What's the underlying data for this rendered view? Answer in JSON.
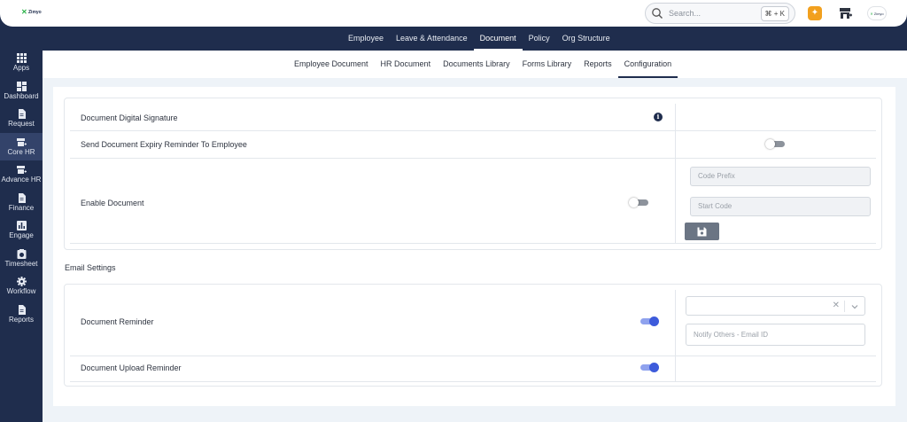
{
  "topbar": {
    "logo_text": "Zimyo",
    "search_placeholder": "Search...",
    "shortcut": "⌘ + K",
    "company_logo_text": "Zimyo"
  },
  "main_nav": [
    "Employee",
    "Leave & Attendance",
    "Document",
    "Policy",
    "Org Structure"
  ],
  "main_nav_active": "Document",
  "sub_nav": [
    "Employee Document",
    "HR Document",
    "Documents Library",
    "Forms Library",
    "Reports",
    "Configuration"
  ],
  "sub_nav_active": "Configuration",
  "sidebar": [
    {
      "label": "Apps",
      "icon": "apps-grid-icon"
    },
    {
      "label": "Dashboard",
      "icon": "dashboard-icon"
    },
    {
      "label": "Request",
      "icon": "request-document-icon"
    },
    {
      "label": "Core HR",
      "icon": "core-hr-shop-icon"
    },
    {
      "label": "Advance HR",
      "icon": "advance-hr-shop-icon"
    },
    {
      "label": "Finance",
      "icon": "finance-document-icon"
    },
    {
      "label": "Engage",
      "icon": "engage-chart-icon"
    },
    {
      "label": "Timesheet",
      "icon": "timesheet-icon"
    },
    {
      "label": "Workflow",
      "icon": "workflow-gear-icon"
    },
    {
      "label": "Reports",
      "icon": "reports-document-icon"
    }
  ],
  "sidebar_active": "Core HR",
  "document_settings": {
    "digital_signature_label": "Document Digital Signature",
    "expiry_reminder_label": "Send Document Expiry Reminder To Employee",
    "expiry_reminder_on": false,
    "enable_document_label": "Enable Document",
    "enable_document_on": false,
    "code_prefix_placeholder": "Code Prefix",
    "start_code_placeholder": "Start Code"
  },
  "email_settings": {
    "title": "Email Settings",
    "document_reminder_label": "Document Reminder",
    "document_reminder_on": true,
    "notify_placeholder": "Notify Others - Email ID",
    "upload_reminder_label": "Document Upload Reminder",
    "upload_reminder_on": true
  },
  "colors": {
    "navy": "#1f2d4d",
    "toggle_on": "#3d5bdb",
    "accent_orange": "#f2a01e"
  }
}
